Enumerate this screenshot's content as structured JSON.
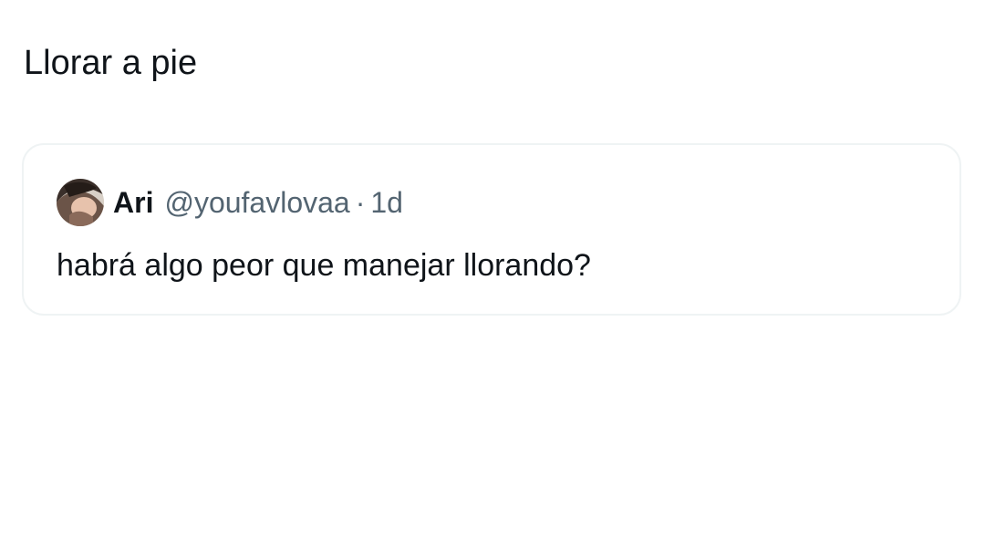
{
  "post": {
    "text": "Llorar a pie"
  },
  "quoted_tweet": {
    "author_name": "Ari",
    "author_handle": "@youfavlovaa",
    "separator": "·",
    "time": "1d",
    "text": "habrá algo peor que manejar llorando?",
    "avatar_icon": "user-avatar"
  },
  "colors": {
    "text_primary": "#0f1419",
    "text_secondary": "#536471",
    "card_border": "#eff3f4",
    "background": "#ffffff"
  }
}
